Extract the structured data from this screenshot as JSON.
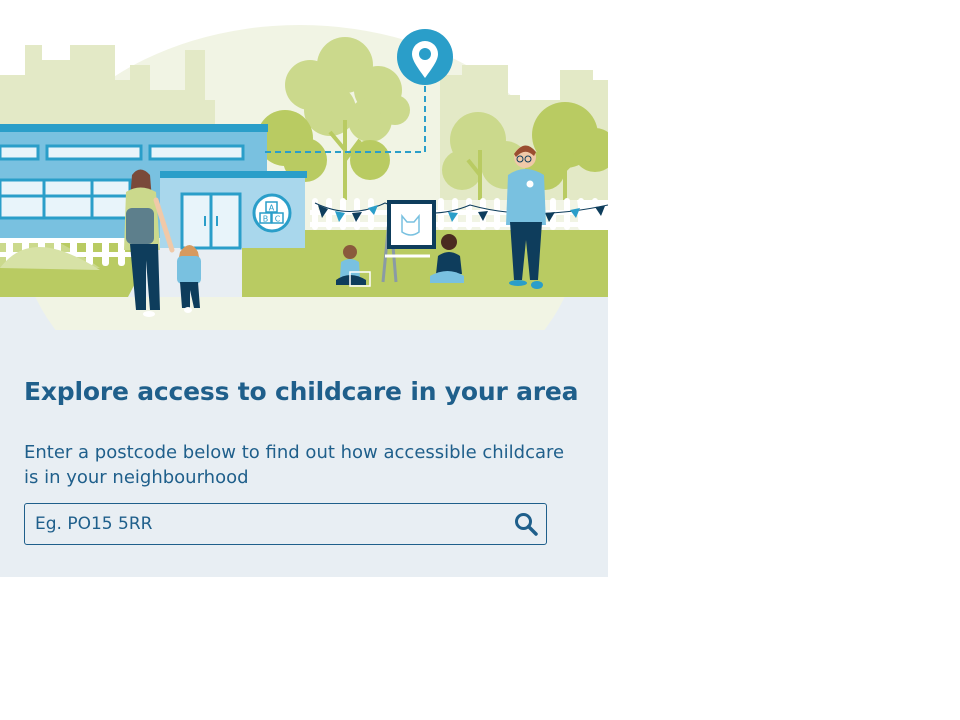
{
  "hero": {
    "illustration": "childcare-neighbourhood-illustration",
    "pin_icon": "location-pin-icon",
    "blocks_sign_icon": "abc-blocks-icon",
    "colors": {
      "sky_green": "#e3e9c6",
      "tree_green": "#b9cb62",
      "tree_light": "#cbd98c",
      "building_blue": "#79c1e0",
      "accent_blue": "#2a9ec9",
      "navy": "#0e3d5c"
    }
  },
  "main": {
    "title": "Explore access to childcare in your area",
    "description": "Enter a postcode below to find out how accessible childcare is in your neighbourhood",
    "search": {
      "placeholder": "Eg. PO15 5RR",
      "value": "",
      "button_icon": "search-icon"
    }
  },
  "colors": {
    "text": "#1f5f8b",
    "panel_background": "#e8eef3"
  }
}
